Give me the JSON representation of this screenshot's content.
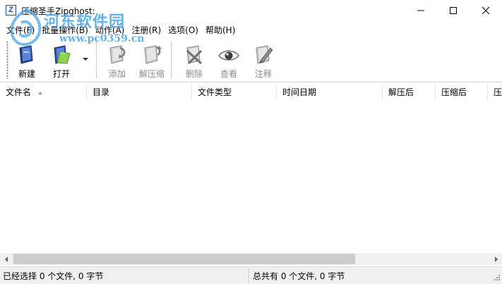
{
  "window": {
    "title": "压缩圣手Zipghost:",
    "app_icon_letter": "Z"
  },
  "watermark": {
    "text": "河东软件园",
    "url": "www.pc0359.cn"
  },
  "menu": {
    "items": [
      {
        "label": "文件(F)"
      },
      {
        "label": "批量操作(B)"
      },
      {
        "label": "动作(A)"
      },
      {
        "label": "注册(R)"
      },
      {
        "label": "选项(O)"
      },
      {
        "label": "帮助(H)"
      }
    ]
  },
  "toolbar": {
    "new_label": "新建",
    "open_label": "打开",
    "add_label": "添加",
    "extract_label": "解压缩",
    "delete_label": "删除",
    "view_label": "查看",
    "comment_label": "注释"
  },
  "list": {
    "columns": [
      {
        "label": "文件名"
      },
      {
        "label": "目录"
      },
      {
        "label": "文件类型"
      },
      {
        "label": "时间日期"
      },
      {
        "label": "解压后"
      },
      {
        "label": "压缩后"
      },
      {
        "label": "压"
      }
    ],
    "sorted_column": "文件名"
  },
  "statusbar": {
    "selected": "已经选择 0 个文件, 0 字节",
    "total": "总共有 0 个文件, 0 字节"
  },
  "colors": {
    "accent": "#1f4fa8",
    "watermark": "#49a6e4",
    "disabled_text": "#8d8d8d"
  }
}
